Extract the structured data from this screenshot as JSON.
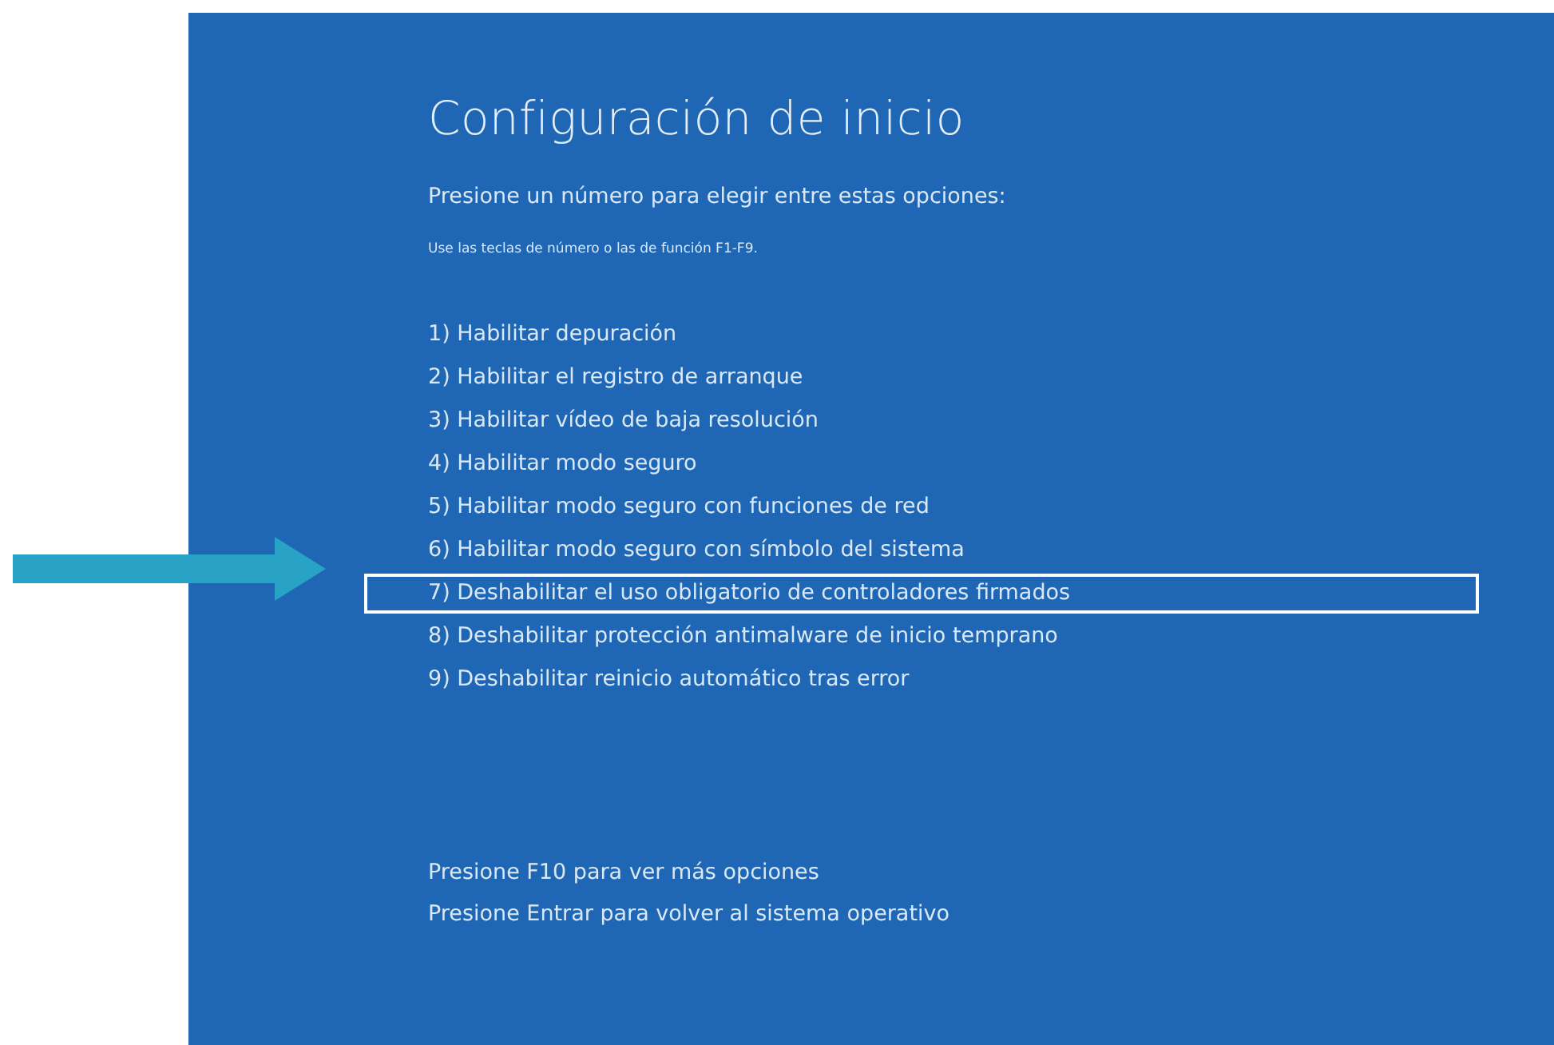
{
  "title": "Configuración de inicio",
  "prompt": "Presione un número para elegir entre estas opciones:",
  "hint": "Use las teclas de número o las de función F1-F9.",
  "options": [
    {
      "label": "1) Habilitar depuración",
      "highlighted": false
    },
    {
      "label": "2) Habilitar el registro de arranque",
      "highlighted": false
    },
    {
      "label": "3) Habilitar vídeo de baja resolución",
      "highlighted": false
    },
    {
      "label": "4) Habilitar modo seguro",
      "highlighted": false
    },
    {
      "label": "5) Habilitar modo seguro con funciones de red",
      "highlighted": false
    },
    {
      "label": "6) Habilitar modo seguro con símbolo del sistema",
      "highlighted": false
    },
    {
      "label": "7) Deshabilitar el uso obligatorio de controladores firmados",
      "highlighted": true
    },
    {
      "label": "8) Deshabilitar protección antimalware de inicio temprano",
      "highlighted": false
    },
    {
      "label": "9) Deshabilitar reinicio automático tras error",
      "highlighted": false
    }
  ],
  "footer": [
    "Presione F10 para ver más opciones",
    "Presione Entrar para volver al sistema operativo"
  ]
}
